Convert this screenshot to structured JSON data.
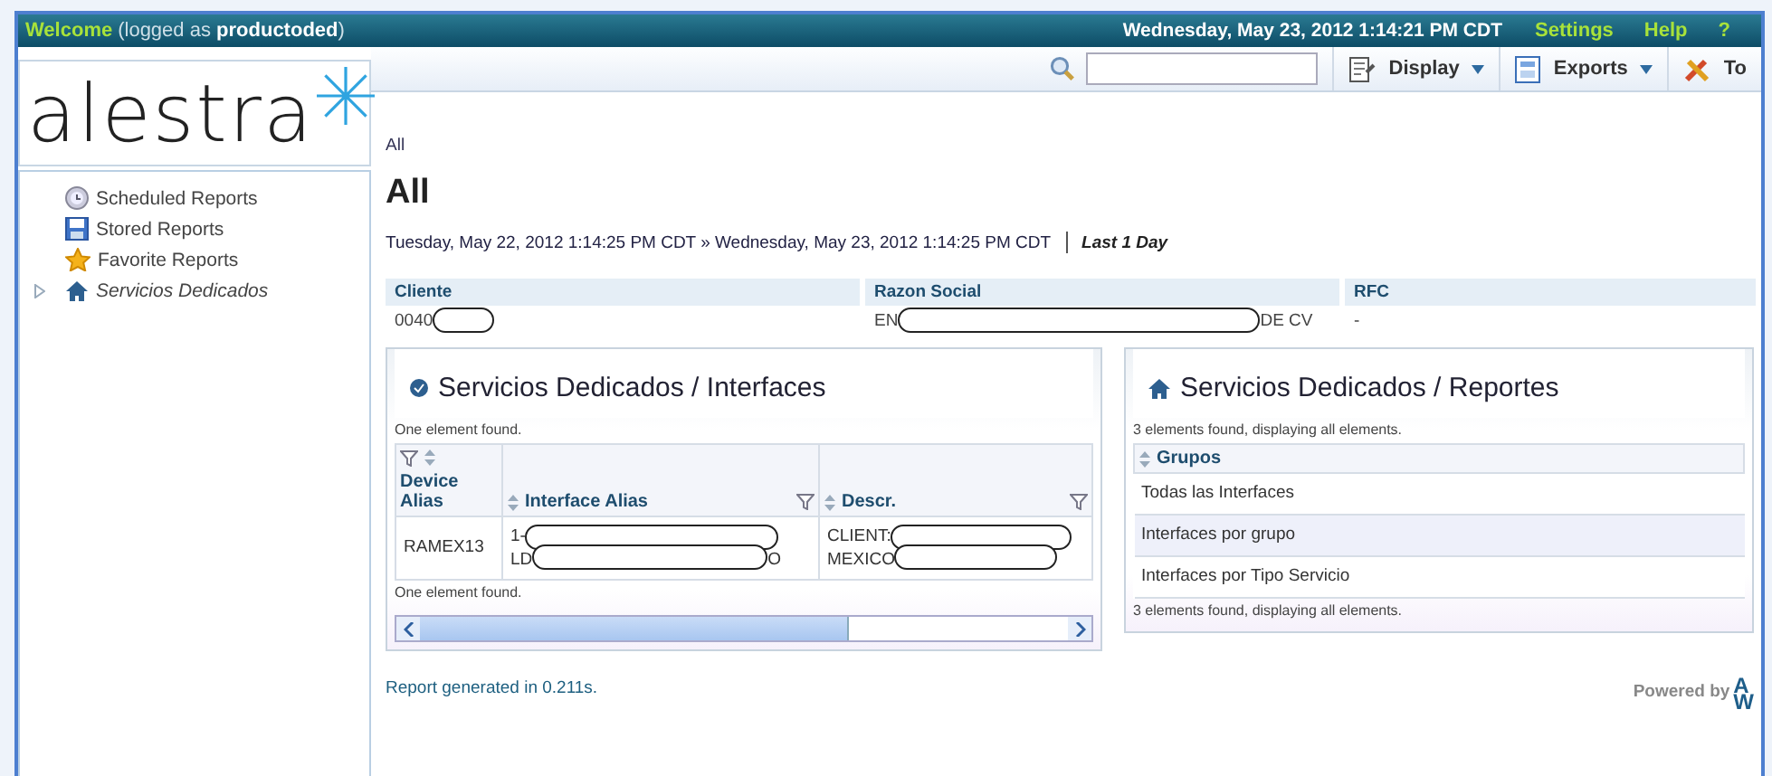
{
  "top_bar": {
    "welcome": "Welcome",
    "logged_as": "(logged as **productoded**)",
    "datetime": "Wednesday, May 23, 2012 1:14:21 PM CDT",
    "links": [
      "Settings",
      "Help",
      "?"
    ]
  },
  "sidebar": {
    "logo": "alestra",
    "items": [
      {
        "label": "Scheduled Reports",
        "kind": "clock",
        "italic": false,
        "expander": false
      },
      {
        "label": "Stored Reports",
        "kind": "disk",
        "italic": false,
        "expander": false
      },
      {
        "label": "Favorite Reports",
        "kind": "star",
        "italic": false,
        "expander": false
      },
      {
        "label": "Servicios Dedicados",
        "kind": "home",
        "italic": true,
        "expander": true
      }
    ]
  },
  "toolbar": {
    "buttons": [
      {
        "label": "Display",
        "kind": "display",
        "dropdown": true
      },
      {
        "label": "Exports",
        "kind": "exports",
        "dropdown": true
      },
      {
        "label": "To",
        "kind": "tools",
        "dropdown": false
      }
    ]
  },
  "breadcrumb": "All",
  "title": "All",
  "period": {
    "range": "Tuesday, May 22, 2012 1:14:25 PM CDT » Wednesday, May 23, 2012 1:14:25 PM CDT",
    "label": "Last 1 Day"
  },
  "info": {
    "columns": [
      "Cliente",
      "Razon Social",
      "RFC"
    ],
    "values": [
      [
        "0040",
        {
          "kind": "redaction"
        }
      ],
      [
        "EN",
        {
          "kind": "redaction"
        },
        "DE CV"
      ],
      [
        "-"
      ]
    ]
  },
  "panels": [
    {
      "title": "Servicios Dedicados / Interfaces",
      "kind": "interfaces",
      "found": "One element found.",
      "columns": [
        {
          "label": "Device Alias",
          "filter": true
        },
        {
          "label": "Interface Alias",
          "filter": true
        },
        {
          "label": "Descr.",
          "filter": true
        }
      ],
      "rows": [
        [
          [
            [
              "RAMEX13"
            ]
          ],
          [
            [
              "1-",
              {
                "kind": "redaction"
              }
            ],
            [
              "LD",
              {
                "kind": "redaction"
              },
              "O"
            ]
          ],
          [
            [
              "CLIENT:",
              {
                "kind": "redaction"
              }
            ],
            [
              "MEXICO",
              {
                "kind": "redaction"
              }
            ]
          ]
        ]
      ],
      "footer": "One element found.",
      "scrollbar": true
    },
    {
      "title": "Servicios Dedicados / Reportes",
      "kind": "reportes",
      "found": "3 elements found, displaying all elements.",
      "columns": [
        {
          "label": "Grupos",
          "filter": false
        }
      ],
      "rows": [
        [
          [
            [
              "Todas las Interfaces"
            ]
          ]
        ],
        [
          [
            [
              "Interfaces por grupo"
            ]
          ]
        ],
        [
          [
            [
              "Interfaces por Tipo Servicio"
            ]
          ]
        ]
      ],
      "footer": "3 elements found, displaying all elements.",
      "scrollbar": false
    }
  ],
  "generated": "Report generated in 0.211s.",
  "powered_by": "Powered by",
  "powered_logo": [
    "A",
    "W"
  ]
}
